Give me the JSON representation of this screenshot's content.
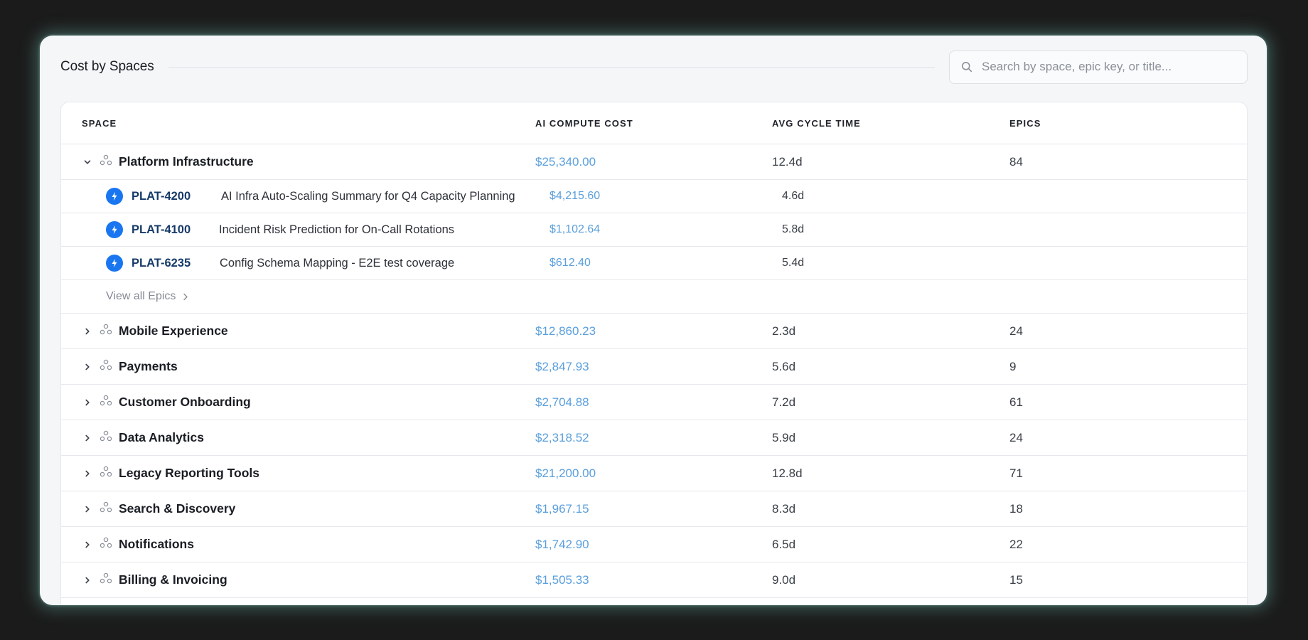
{
  "header": {
    "title": "Cost by Spaces",
    "search_placeholder": "Search by space, epic key, or title..."
  },
  "columns": {
    "space": "SPACE",
    "cost": "AI COMPUTE COST",
    "cycle": "AVG CYCLE TIME",
    "epics": "EPICS"
  },
  "expanded": {
    "name": "Platform Infrastructure",
    "cost": "$25,340.00",
    "cycle": "12.4d",
    "epics": "84",
    "children": [
      {
        "key": "PLAT-4200",
        "title": "AI Infra Auto-Scaling Summary for Q4 Capacity Planning",
        "cost": "$4,215.60",
        "cycle": "4.6d"
      },
      {
        "key": "PLAT-4100",
        "title": "Incident Risk Prediction for On-Call Rotations",
        "cost": "$1,102.64",
        "cycle": "5.8d"
      },
      {
        "key": "PLAT-6235",
        "title": "Config Schema Mapping - E2E test coverage",
        "cost": "$612.40",
        "cycle": "5.4d"
      }
    ],
    "view_all_label": "View all Epics"
  },
  "rows": [
    {
      "name": "Mobile Experience",
      "cost": "$12,860.23",
      "cycle": "2.3d",
      "epics": "24"
    },
    {
      "name": "Payments",
      "cost": "$2,847.93",
      "cycle": "5.6d",
      "epics": "9"
    },
    {
      "name": "Customer Onboarding",
      "cost": "$2,704.88",
      "cycle": "7.2d",
      "epics": "61"
    },
    {
      "name": "Data Analytics",
      "cost": "$2,318.52",
      "cycle": "5.9d",
      "epics": "24"
    },
    {
      "name": "Legacy Reporting Tools",
      "cost": "$21,200.00",
      "cycle": "12.8d",
      "epics": "71"
    },
    {
      "name": "Search & Discovery",
      "cost": "$1,967.15",
      "cycle": "8.3d",
      "epics": "18"
    },
    {
      "name": "Notifications",
      "cost": "$1,742.90",
      "cycle": "6.5d",
      "epics": "22"
    },
    {
      "name": "Billing & Invoicing",
      "cost": "$1,505.33",
      "cycle": "9.0d",
      "epics": "15"
    }
  ],
  "colors": {
    "accent": "#1976f0",
    "cost_text": "#5a9fdc",
    "epic_key": "#173b69"
  }
}
